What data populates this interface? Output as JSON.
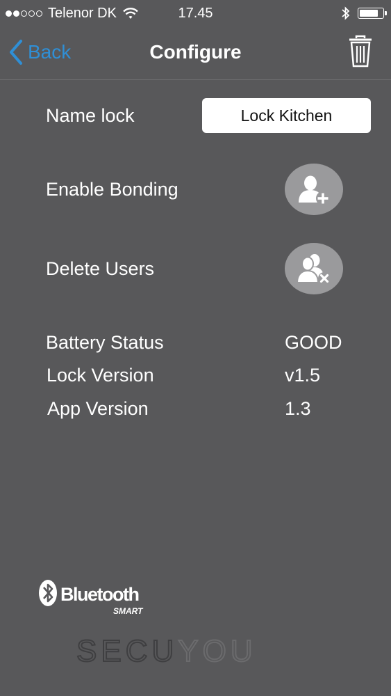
{
  "status_bar": {
    "carrier": "Telenor DK",
    "time": "17.45",
    "signal_bars_filled": 2,
    "signal_bars_total": 5
  },
  "nav": {
    "back_label": "Back",
    "title": "Configure"
  },
  "form": {
    "name_label": "Name lock",
    "name_value": "Lock Kitchen",
    "bonding_label": "Enable Bonding",
    "delete_label": "Delete Users"
  },
  "info": {
    "battery_label": "Battery Status",
    "battery_value": "GOOD",
    "lock_version_label": "Lock Version",
    "lock_version_value": "v1.5",
    "app_version_label": "App Version",
    "app_version_value": "1.3"
  },
  "branding": {
    "bluetooth_text": "Bluetooth",
    "bluetooth_sub": "SMART",
    "brand_part1": "SECU",
    "brand_part2": "YOU"
  },
  "colors": {
    "background": "#58585a",
    "accent": "#2f8fd6",
    "button_circle": "#9a9a9c"
  }
}
